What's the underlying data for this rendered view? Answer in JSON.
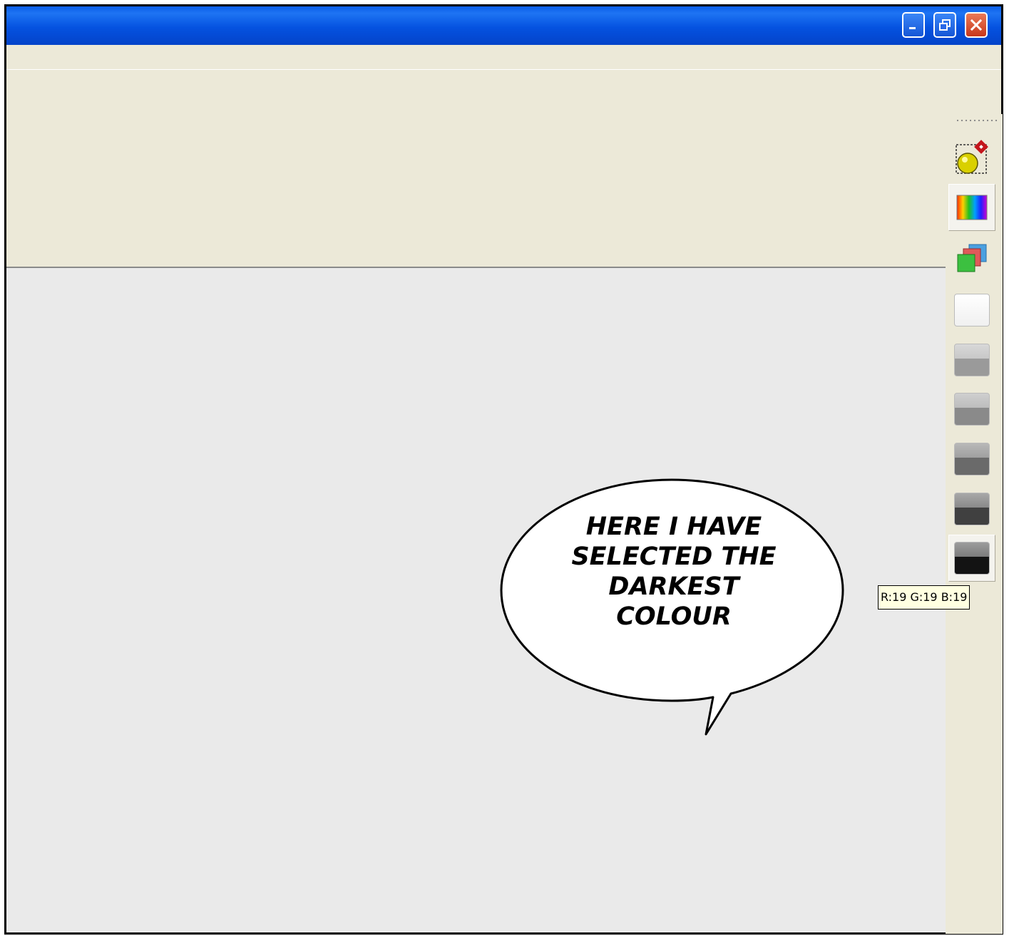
{
  "window": {
    "controls": [
      "minimize",
      "restore",
      "close"
    ]
  },
  "side_toolbar": {
    "tools": [
      {
        "name": "color-picker-tool",
        "icon": "eyedropper-sphere-icon"
      },
      {
        "name": "color-spectrum-tool",
        "icon": "rainbow-spectrum-icon",
        "selected": true
      },
      {
        "name": "layers-tool",
        "icon": "stacked-squares-icon"
      },
      {
        "name": "swatch-1",
        "color": "#f7f7f7"
      },
      {
        "name": "swatch-2",
        "color": "#9a9a9a"
      },
      {
        "name": "swatch-3",
        "color": "#8a8a8a"
      },
      {
        "name": "swatch-4",
        "color": "#6a6a6a"
      },
      {
        "name": "swatch-5",
        "color": "#404040"
      },
      {
        "name": "swatch-6",
        "color": "#131313"
      }
    ]
  },
  "tooltip": {
    "text": "R:19 G:19 B:19"
  },
  "speech_bubble": {
    "text": "Here I have selected the darkest colour"
  },
  "colors": {
    "titlebar": "#0552e0",
    "chrome": "#ece9d8",
    "canvas": "#eaeaea",
    "tooltip_bg": "#ffffe1"
  }
}
